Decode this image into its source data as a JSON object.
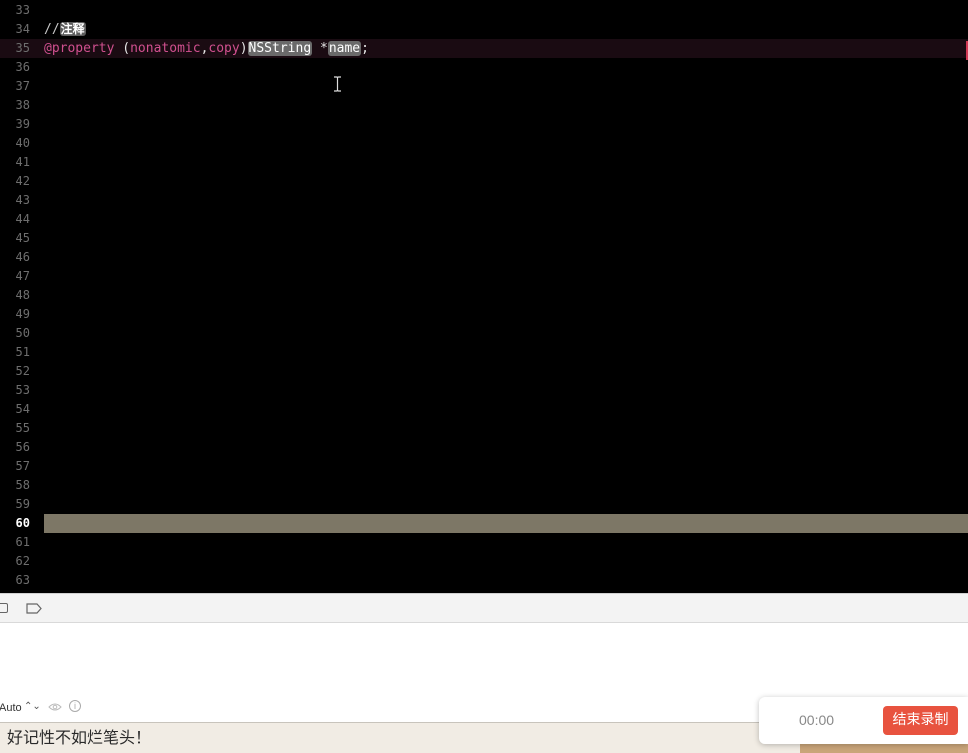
{
  "editor": {
    "lines": [
      {
        "n": "33",
        "text": ""
      },
      {
        "n": "34",
        "text": ""
      },
      {
        "n": "35",
        "text": ""
      },
      {
        "n": "36",
        "text": ""
      },
      {
        "n": "37",
        "text": ""
      },
      {
        "n": "38",
        "text": ""
      },
      {
        "n": "39",
        "text": ""
      },
      {
        "n": "40",
        "text": ""
      },
      {
        "n": "41",
        "text": ""
      },
      {
        "n": "42",
        "text": ""
      },
      {
        "n": "43",
        "text": ""
      },
      {
        "n": "44",
        "text": ""
      },
      {
        "n": "45",
        "text": ""
      },
      {
        "n": "46",
        "text": ""
      },
      {
        "n": "47",
        "text": ""
      },
      {
        "n": "48",
        "text": ""
      },
      {
        "n": "49",
        "text": ""
      },
      {
        "n": "50",
        "text": ""
      },
      {
        "n": "51",
        "text": ""
      },
      {
        "n": "52",
        "text": ""
      },
      {
        "n": "53",
        "text": ""
      },
      {
        "n": "54",
        "text": ""
      },
      {
        "n": "55",
        "text": ""
      },
      {
        "n": "56",
        "text": ""
      },
      {
        "n": "57",
        "text": ""
      },
      {
        "n": "58",
        "text": ""
      },
      {
        "n": "59",
        "text": ""
      },
      {
        "n": "60",
        "text": ""
      },
      {
        "n": "61",
        "text": ""
      },
      {
        "n": "62",
        "text": ""
      },
      {
        "n": "63",
        "text": ""
      }
    ],
    "current_line": "60",
    "comment": {
      "prefix": "//",
      "text": "注释"
    },
    "property_line": {
      "at_property": "@property",
      "space1": " (",
      "nonatomic": "nonatomic",
      "comma": ",",
      "copy": "copy",
      "close": ")",
      "type": "NSString",
      "space2": " *",
      "name": "name",
      "semi": ";"
    }
  },
  "console": {
    "filter_mode": "Auto",
    "filter_chevron": "⌃⌄"
  },
  "bottom": {
    "text": "好记性不如烂笔头！"
  },
  "recorder": {
    "time": "00:00",
    "stop_label": "结束录制"
  },
  "colors": {
    "keyword": "#d0508f",
    "highlight_line": "#7d7766",
    "record_button": "#e8533f"
  }
}
